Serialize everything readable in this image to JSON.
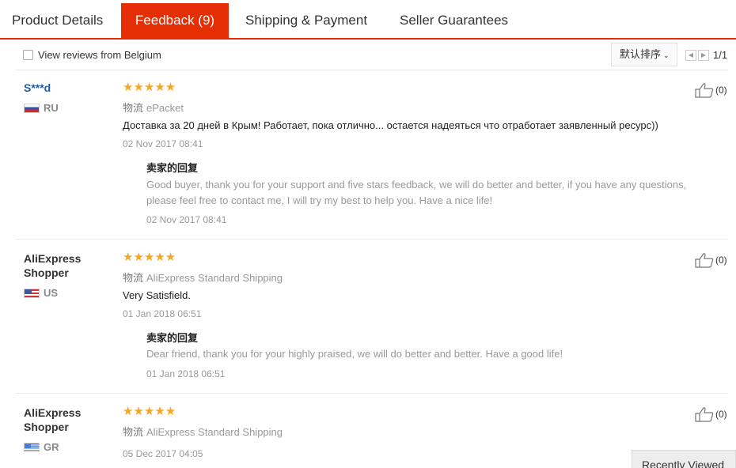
{
  "tabs": [
    {
      "label": "Product Details"
    },
    {
      "label": "Feedback (9)"
    },
    {
      "label": "Shipping & Payment"
    },
    {
      "label": "Seller Guarantees"
    }
  ],
  "filter": {
    "checkbox_label": "View reviews from Belgium",
    "sort_label": "默认排序",
    "pagination": "1/1"
  },
  "reviews": [
    {
      "user": "S***d",
      "country": "RU",
      "stars": "★★★★★",
      "logistics_label": "物流",
      "logistics": "ePacket",
      "content": "Доставка за 20 дней в Крым! Работает, пока отлично... остается надеяться что отработает заявленный ресурс))",
      "date": "02 Nov 2017 08:41",
      "reply_title": "卖家的回复",
      "reply": "Good buyer, thank you for your support and five stars feedback, we will do better and better, if you have any questions, please feel free to contact me, I will try my best to help you. Have a nice life!",
      "reply_date": "02 Nov 2017 08:41",
      "likes": "(0)"
    },
    {
      "user": "AliExpress Shopper",
      "country": "US",
      "stars": "★★★★★",
      "logistics_label": "物流",
      "logistics": "AliExpress Standard Shipping",
      "content": "Very Satisfield.",
      "date": "01 Jan 2018 06:51",
      "reply_title": "卖家的回复",
      "reply": "Dear friend, thank you for your highly praised, we will do better and better. Have a good life!",
      "reply_date": "01 Jan 2018 06:51",
      "likes": "(0)"
    },
    {
      "user": "AliExpress Shopper",
      "country": "GR",
      "stars": "★★★★★",
      "logistics_label": "物流",
      "logistics": "AliExpress Standard Shipping",
      "date": "05 Dec 2017 04:05",
      "likes": "(0)"
    }
  ],
  "recently_viewed": "Recently Viewed",
  "colors": {
    "accent": "#e62e04",
    "stars": "#f5a623",
    "user_link": "#1f5ba7"
  },
  "icons": {
    "like": "thumbs-up-icon",
    "prev": "arrow-left-icon",
    "next": "arrow-right-icon",
    "sort": "chevron-down-icon"
  }
}
